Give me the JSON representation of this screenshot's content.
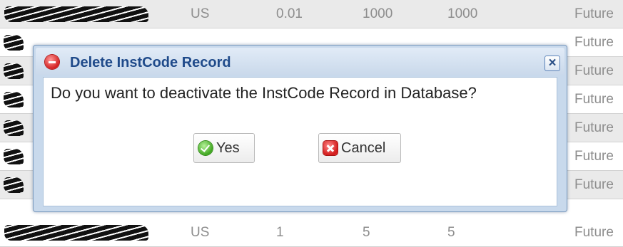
{
  "grid": {
    "rows": [
      {
        "country": "US",
        "tick": "0.01",
        "min": "1000",
        "max": "1000",
        "type": "Future"
      },
      {
        "type": "Future"
      },
      {
        "type": "Future"
      },
      {
        "type": "Future"
      },
      {
        "type": "Future"
      },
      {
        "type": "Future"
      },
      {
        "type": "Future"
      },
      {
        "country": "US",
        "tick": "1",
        "min": "5",
        "max": "5",
        "type": "Future"
      }
    ]
  },
  "dialog": {
    "title": "Delete InstCode Record",
    "close_label": "×",
    "message": "Do you want to deactivate the InstCode Record in Database?",
    "yes_label": "Yes",
    "cancel_label": "Cancel",
    "title_icon": "minus-circle-icon",
    "yes_icon": "check-circle-icon",
    "cancel_icon": "x-square-icon"
  },
  "colors": {
    "title_text": "#1f4a8a",
    "dialog_border": "#7d9cbf",
    "row_alt": "#eaeaea",
    "cell_text": "#8d8d8d"
  }
}
